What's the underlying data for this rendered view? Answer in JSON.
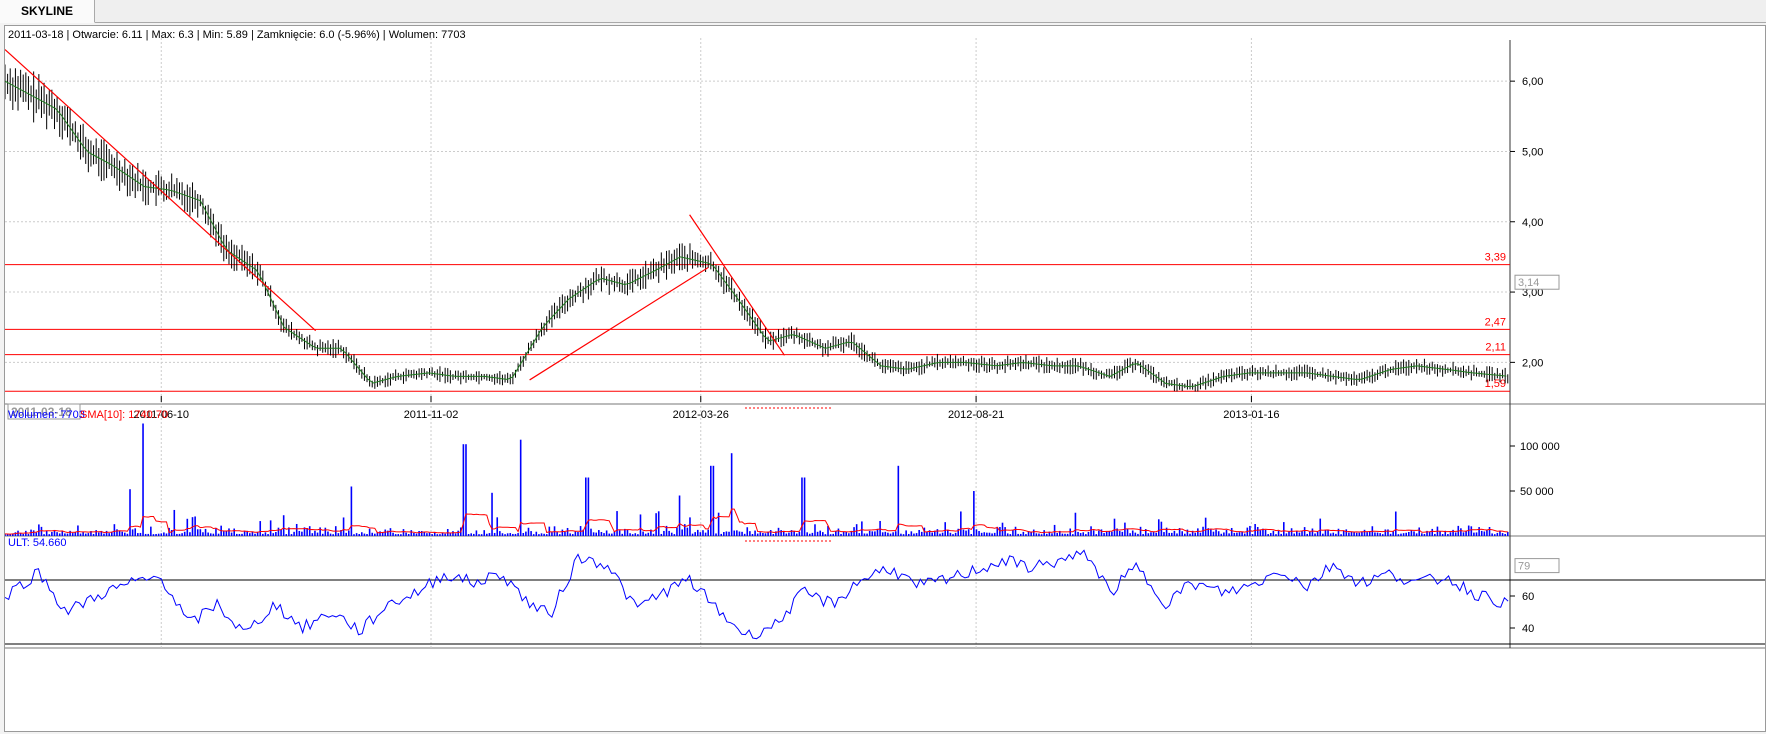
{
  "tab": {
    "label": "SKYLINE"
  },
  "price_panel": {
    "info": "2011-03-18 | Otwarcie: 6.11 | Max: 6.3 | Min: 5.89 | Zamknięcie: 6.0 (-5.96%)  | Wolumen: 7703",
    "current_label": "3,14",
    "cursor_date": "2011-03-18"
  },
  "volume_panel": {
    "label": "Wolumen: 7703",
    "sma_label": "SMA[10]: 1740.70"
  },
  "ult_panel": {
    "label": "ULT: 54.660",
    "current_label": "79"
  },
  "colors": {
    "price_bars": "#000000",
    "ma_line": "#1f7a1f",
    "trend_lines": "#ff0000",
    "volume_bars": "#0000ff",
    "sma_line": "#ff0000",
    "ult_line": "#0000ff"
  },
  "chart_data": [
    {
      "type": "ohlc",
      "x_tick_labels": [
        "2011-06-10",
        "2011-11-02",
        "2012-03-26",
        "2012-08-21",
        "2013-01-16"
      ],
      "y_tick_labels": [
        "2,00",
        "3,00",
        "4,00",
        "5,00",
        "6,00"
      ],
      "ylim": [
        1.55,
        6.5
      ],
      "x_range": [
        "2011-03-18",
        "2013-06-04"
      ],
      "grid": true,
      "horizontal_levels": [
        3.39,
        2.47,
        2.11,
        1.59
      ],
      "horizontal_level_labels": [
        "3,39",
        "2,47",
        "2,11",
        "1,59"
      ],
      "trend_lines": [
        {
          "from": [
            "2011-03-18",
            6.45
          ],
          "to": [
            "2011-09-01",
            2.45
          ]
        },
        {
          "from": [
            "2011-12-25",
            1.75
          ],
          "to": [
            "2012-03-30",
            3.35
          ]
        },
        {
          "from": [
            "2012-03-20",
            4.1
          ],
          "to": [
            "2012-05-10",
            2.1
          ]
        }
      ],
      "close_series": [
        [
          "2011-03-18",
          6.0
        ],
        [
          "2011-04-01",
          5.8
        ],
        [
          "2011-04-15",
          5.6
        ],
        [
          "2011-05-01",
          5.0
        ],
        [
          "2011-05-15",
          4.8
        ],
        [
          "2011-06-01",
          4.5
        ],
        [
          "2011-06-15",
          4.45
        ],
        [
          "2011-07-01",
          4.3
        ],
        [
          "2011-07-15",
          3.6
        ],
        [
          "2011-08-01",
          3.3
        ],
        [
          "2011-08-15",
          2.5
        ],
        [
          "2011-09-01",
          2.2
        ],
        [
          "2011-09-15",
          2.2
        ],
        [
          "2011-10-01",
          1.7
        ],
        [
          "2011-10-15",
          1.8
        ],
        [
          "2011-11-01",
          1.85
        ],
        [
          "2011-11-15",
          1.8
        ],
        [
          "2011-12-01",
          1.8
        ],
        [
          "2011-12-15",
          1.75
        ],
        [
          "2012-01-01",
          2.5
        ],
        [
          "2012-01-15",
          2.9
        ],
        [
          "2012-02-01",
          3.2
        ],
        [
          "2012-02-15",
          3.1
        ],
        [
          "2012-03-01",
          3.3
        ],
        [
          "2012-03-15",
          3.5
        ],
        [
          "2012-04-01",
          3.4
        ],
        [
          "2012-04-15",
          2.9
        ],
        [
          "2012-05-01",
          2.3
        ],
        [
          "2012-05-15",
          2.4
        ],
        [
          "2012-06-01",
          2.2
        ],
        [
          "2012-06-15",
          2.3
        ],
        [
          "2012-07-01",
          1.95
        ],
        [
          "2012-07-15",
          1.9
        ],
        [
          "2012-08-01",
          2.0
        ],
        [
          "2012-08-15",
          2.0
        ],
        [
          "2012-09-01",
          1.95
        ],
        [
          "2012-09-15",
          2.0
        ],
        [
          "2012-10-01",
          1.95
        ],
        [
          "2012-10-15",
          1.95
        ],
        [
          "2012-11-01",
          1.8
        ],
        [
          "2012-11-15",
          2.0
        ],
        [
          "2012-12-01",
          1.7
        ],
        [
          "2012-12-15",
          1.65
        ],
        [
          "2013-01-01",
          1.8
        ],
        [
          "2013-01-15",
          1.85
        ],
        [
          "2013-02-01",
          1.85
        ],
        [
          "2013-02-15",
          1.85
        ],
        [
          "2013-03-01",
          1.8
        ],
        [
          "2013-03-15",
          1.75
        ],
        [
          "2013-04-01",
          1.9
        ],
        [
          "2013-04-15",
          1.95
        ],
        [
          "2013-05-01",
          1.9
        ],
        [
          "2013-05-15",
          1.85
        ],
        [
          "2013-06-04",
          1.8
        ]
      ]
    },
    {
      "type": "bar",
      "series_name": "Wolumen",
      "y_tick_labels": [
        "50 000",
        "100 000"
      ],
      "ylim": [
        0,
        120000
      ],
      "spikes": [
        [
          "2011-05-24",
          52000
        ],
        [
          "2011-05-31",
          125000
        ],
        [
          "2011-09-20",
          55000
        ],
        [
          "2011-11-20",
          102000
        ],
        [
          "2011-12-05",
          48000
        ],
        [
          "2011-12-20",
          107000
        ],
        [
          "2012-01-25",
          65000
        ],
        [
          "2012-03-15",
          45000
        ],
        [
          "2012-04-01",
          78000
        ],
        [
          "2012-04-12",
          92000
        ],
        [
          "2012-05-20",
          65000
        ],
        [
          "2012-07-10",
          78000
        ],
        [
          "2012-08-20",
          50000
        ]
      ],
      "sma": {
        "name": "SMA[10]",
        "value": 1740.7
      }
    },
    {
      "type": "line",
      "series_name": "ULT",
      "y_tick_labels": [
        "40",
        "60"
      ],
      "ylim": [
        30,
        90
      ],
      "reference_levels": [
        70,
        30
      ],
      "values": [
        [
          "2011-03-18",
          60
        ],
        [
          "2011-04-05",
          75
        ],
        [
          "2011-04-20",
          50
        ],
        [
          "2011-05-10",
          62
        ],
        [
          "2011-05-25",
          68
        ],
        [
          "2011-06-10",
          72
        ],
        [
          "2011-06-25",
          42
        ],
        [
          "2011-07-10",
          55
        ],
        [
          "2011-07-25",
          36
        ],
        [
          "2011-08-10",
          55
        ],
        [
          "2011-08-25",
          40
        ],
        [
          "2011-09-10",
          50
        ],
        [
          "2011-09-25",
          38
        ],
        [
          "2011-10-10",
          55
        ],
        [
          "2011-10-25",
          62
        ],
        [
          "2011-11-10",
          74
        ],
        [
          "2011-11-25",
          68
        ],
        [
          "2011-12-10",
          74
        ],
        [
          "2011-12-25",
          55
        ],
        [
          "2012-01-05",
          48
        ],
        [
          "2012-01-20",
          84
        ],
        [
          "2012-02-05",
          80
        ],
        [
          "2012-02-20",
          52
        ],
        [
          "2012-03-05",
          62
        ],
        [
          "2012-03-20",
          70
        ],
        [
          "2012-04-05",
          50
        ],
        [
          "2012-04-20",
          35
        ],
        [
          "2012-05-05",
          42
        ],
        [
          "2012-05-20",
          62
        ],
        [
          "2012-06-05",
          55
        ],
        [
          "2012-06-20",
          70
        ],
        [
          "2012-07-05",
          78
        ],
        [
          "2012-07-20",
          66
        ],
        [
          "2012-08-05",
          70
        ],
        [
          "2012-08-20",
          76
        ],
        [
          "2012-09-05",
          82
        ],
        [
          "2012-09-20",
          78
        ],
        [
          "2012-10-05",
          82
        ],
        [
          "2012-10-20",
          86
        ],
        [
          "2012-11-01",
          62
        ],
        [
          "2012-11-15",
          78
        ],
        [
          "2012-12-01",
          56
        ],
        [
          "2012-12-15",
          68
        ],
        [
          "2013-01-01",
          62
        ],
        [
          "2013-01-15",
          66
        ],
        [
          "2013-02-01",
          76
        ],
        [
          "2013-02-15",
          66
        ],
        [
          "2013-03-01",
          80
        ],
        [
          "2013-03-15",
          68
        ],
        [
          "2013-04-01",
          74
        ],
        [
          "2013-04-15",
          68
        ],
        [
          "2013-05-01",
          72
        ],
        [
          "2013-05-15",
          62
        ],
        [
          "2013-06-04",
          54.66
        ]
      ]
    }
  ]
}
